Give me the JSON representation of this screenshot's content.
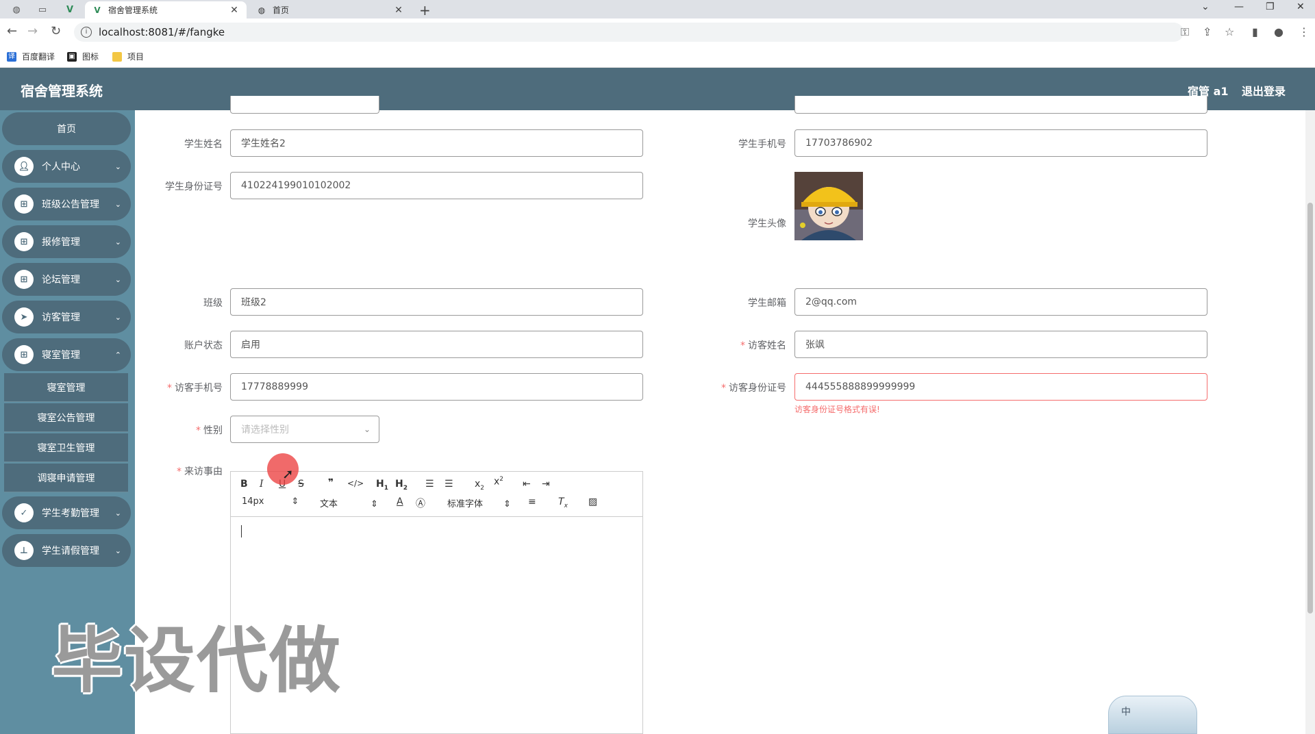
{
  "browser": {
    "tabs": [
      {
        "title": "宿舍管理系统",
        "active": true
      },
      {
        "title": "首页",
        "active": false
      }
    ],
    "url": "localhost:8081/#/fangke",
    "bookmarks": [
      "百度翻译",
      "图标",
      "项目"
    ]
  },
  "header": {
    "title": "宿舍管理系统",
    "user": "宿管 a1",
    "logout": "退出登录",
    "bg_color": "#4e6c7c"
  },
  "sidebar": {
    "bg_color": "#5f8ea1",
    "home": "首页",
    "items": [
      {
        "label": "个人中心",
        "icon": "user-icon"
      },
      {
        "label": "班级公告管理",
        "icon": "grid-icon"
      },
      {
        "label": "报修管理",
        "icon": "grid-icon"
      },
      {
        "label": "论坛管理",
        "icon": "grid-icon"
      },
      {
        "label": "访客管理",
        "icon": "send-icon"
      },
      {
        "label": "寝室管理",
        "icon": "grid-icon"
      }
    ],
    "submenu": [
      "寝室管理",
      "寝室公告管理",
      "寝室卫生管理",
      "调寝申请管理"
    ],
    "items_after": [
      {
        "label": "学生考勤管理",
        "icon": "clipboard-icon"
      },
      {
        "label": "学生请假管理",
        "icon": "stamp-icon"
      }
    ]
  },
  "watermark": "毕设代做",
  "form": {
    "student_name": {
      "label": "学生姓名",
      "value": "学生姓名2"
    },
    "student_phone": {
      "label": "学生手机号",
      "value": "17703786902"
    },
    "student_id": {
      "label": "学生身份证号",
      "value": "410224199010102002"
    },
    "student_avatar": {
      "label": "学生头像"
    },
    "class": {
      "label": "班级",
      "value": "班级2"
    },
    "email": {
      "label": "学生邮箱",
      "value": "2@qq.com"
    },
    "account_status": {
      "label": "账户状态",
      "value": "启用"
    },
    "visitor_name": {
      "label": "访客姓名",
      "value": "张飒"
    },
    "visitor_phone": {
      "label": "访客手机号",
      "value": "17778889999"
    },
    "visitor_id": {
      "label": "访客身份证号",
      "value": "444555888899999999",
      "error": "访客身份证号格式有误!"
    },
    "gender": {
      "label": "性别",
      "placeholder": "请选择性别"
    },
    "reason": {
      "label": "来访事由"
    }
  },
  "editor": {
    "font_size": "14px",
    "block_type": "文本",
    "font_family": "标准字体"
  },
  "ime": {
    "mode": "中"
  }
}
